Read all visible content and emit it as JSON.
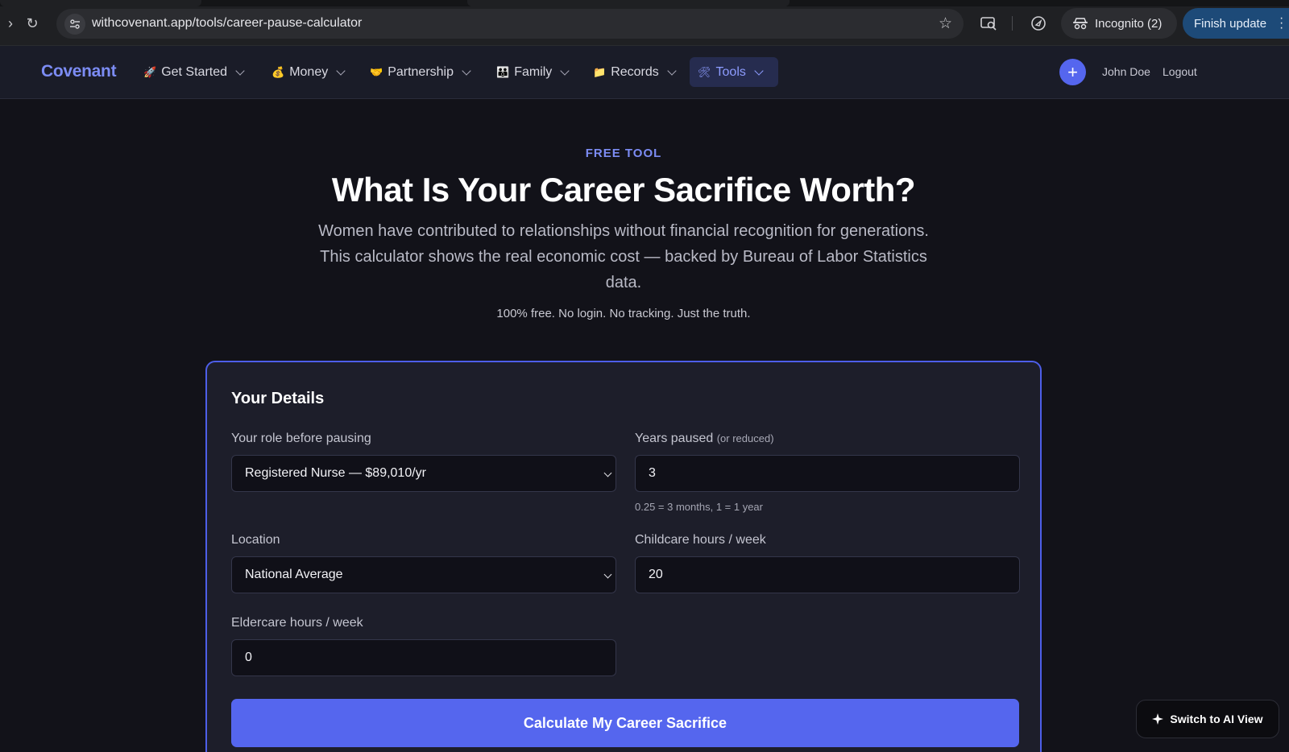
{
  "browser": {
    "url": "withcovenant.app/tools/career-pause-calculator",
    "incognito_label": "Incognito (2)",
    "finish_update_label": "Finish update"
  },
  "header": {
    "logo": "Covenant",
    "nav": [
      {
        "icon": "🚀",
        "label": "Get Started"
      },
      {
        "icon": "💰",
        "label": "Money"
      },
      {
        "icon": "🤝",
        "label": "Partnership"
      },
      {
        "icon": "👪",
        "label": "Family"
      },
      {
        "icon": "📁",
        "label": "Records"
      },
      {
        "icon": "🛠",
        "label": "Tools"
      }
    ],
    "plus_label": "+",
    "user_name": "John Doe",
    "logout_label": "Logout"
  },
  "hero": {
    "eyebrow": "FREE TOOL",
    "title": "What Is Your Career Sacrifice Worth?",
    "description": "Women have contributed to relationships without financial recognition for generations. This calculator shows the real economic cost — backed by Bureau of Labor Statistics data.",
    "note": "100% free. No login. No tracking. Just the truth."
  },
  "form": {
    "title": "Your Details",
    "role": {
      "label": "Your role before pausing",
      "value": "Registered Nurse — $89,010/yr"
    },
    "years": {
      "label": "Years paused",
      "sublabel": "(or reduced)",
      "value": "3",
      "hint": "0.25 = 3 months, 1 = 1 year"
    },
    "location": {
      "label": "Location",
      "value": "National Average"
    },
    "childcare": {
      "label": "Childcare hours / week",
      "value": "20"
    },
    "eldercare": {
      "label": "Eldercare hours / week",
      "value": "0"
    },
    "submit_label": "Calculate My Career Sacrifice"
  },
  "ai_toggle": {
    "label": "Switch to AI View"
  },
  "colors": {
    "accent": "#5566ee",
    "accent_text": "#7c8cf4",
    "background": "#121219",
    "card": "#1d1e2a"
  }
}
